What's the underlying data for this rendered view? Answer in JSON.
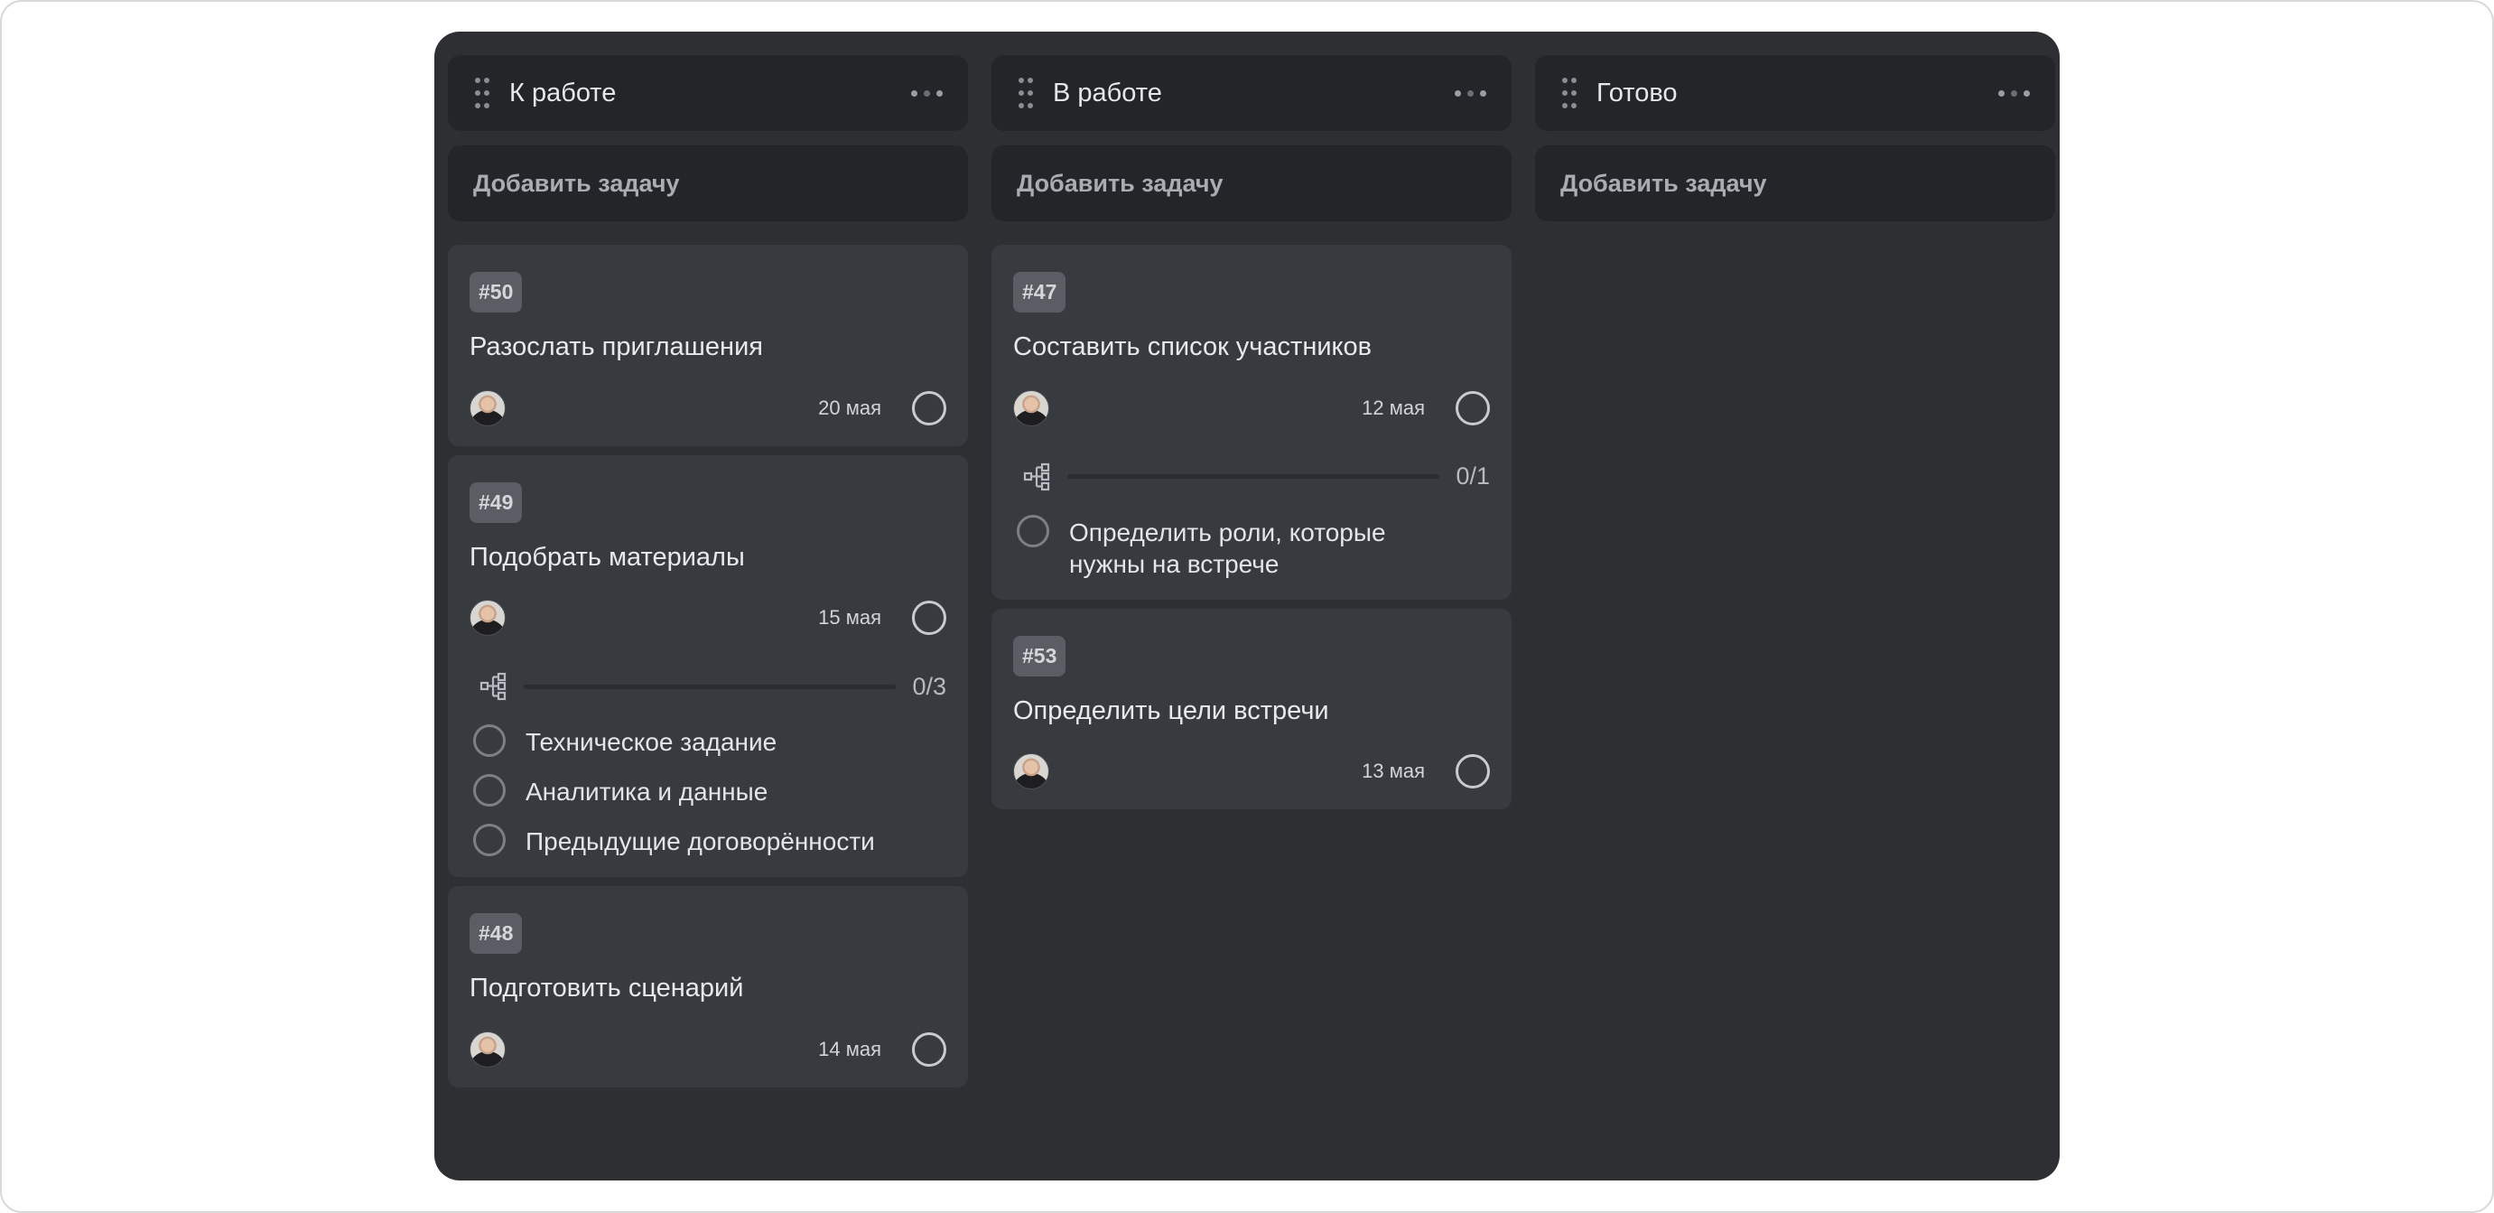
{
  "columns": [
    {
      "title": "К работе",
      "add_task_label": "Добавить задачу",
      "cards": [
        {
          "tag": "#50",
          "title": "Разослать приглашения",
          "date": "20 мая"
        },
        {
          "tag": "#49",
          "title": "Подобрать материалы",
          "date": "15 мая",
          "subtasks": {
            "count": "0/3",
            "progress": 0,
            "items": [
              "Техническое задание",
              "Аналитика и данные",
              "Предыдущие договорённости"
            ]
          }
        },
        {
          "tag": "#48",
          "title": "Подготовить сценарий",
          "date": "14 мая"
        }
      ]
    },
    {
      "title": "В работе",
      "add_task_label": "Добавить задачу",
      "cards": [
        {
          "tag": "#47",
          "title": "Составить список участников",
          "date": "12 мая",
          "subtasks": {
            "count": "0/1",
            "progress": 0,
            "items": [
              "Определить роли, которые нужны на встрече"
            ]
          }
        },
        {
          "tag": "#53",
          "title": "Определить цели встречи",
          "date": "13 мая"
        }
      ]
    },
    {
      "title": "Готово",
      "add_task_label": "Добавить задачу",
      "cards": []
    }
  ],
  "icons": {
    "drag": "drag-handle-icon",
    "more": "more-dots-icon",
    "subtasks": "subtasks-tree-icon",
    "status": "status-circle-icon"
  },
  "colors": {
    "board_bg": "#2d2f33",
    "card_bg": "#373a3f",
    "header_bg": "#232528"
  }
}
